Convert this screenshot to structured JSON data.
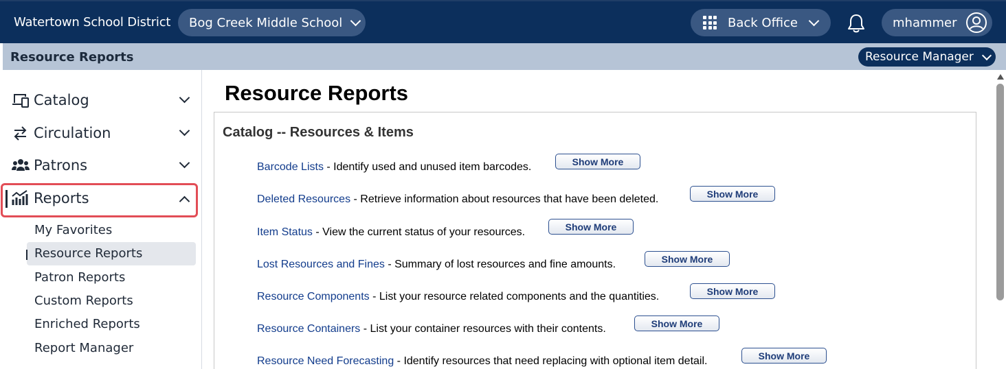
{
  "topbar": {
    "district": "Watertown School District",
    "school": "Bog Creek Middle School",
    "office": "Back Office",
    "user": "mhammer"
  },
  "subbar": {
    "title": "Resource Reports",
    "role": "Resource Manager"
  },
  "sidebar": {
    "items": [
      {
        "label": "Catalog",
        "icon": "catalog-icon"
      },
      {
        "label": "Circulation",
        "icon": "circulation-icon"
      },
      {
        "label": "Patrons",
        "icon": "patrons-icon"
      },
      {
        "label": "Reports",
        "icon": "reports-icon"
      }
    ],
    "sub_items": [
      "My Favorites",
      "Resource Reports",
      "Patron Reports",
      "Custom Reports",
      "Enriched Reports",
      "Report Manager"
    ]
  },
  "main": {
    "title": "Resource Reports",
    "section_title": "Catalog -- Resources & Items",
    "show_more_label": "Show More",
    "reports": [
      {
        "name": "Barcode Lists",
        "desc": " - Identify used and unused item barcodes."
      },
      {
        "name": "Deleted Resources",
        "desc": " - Retrieve information about resources that have been deleted."
      },
      {
        "name": "Item Status",
        "desc": " - View the current status of your resources."
      },
      {
        "name": "Lost Resources and Fines",
        "desc": " - Summary of lost resources and fine amounts."
      },
      {
        "name": "Resource Components",
        "desc": " - List your resource related components and the quantities."
      },
      {
        "name": "Resource Containers",
        "desc": " - List your container resources with their contents."
      },
      {
        "name": "Resource Need Forecasting",
        "desc": " - Identify resources that need replacing with optional item detail."
      }
    ]
  },
  "colors": {
    "topbar": "#0c2f5c",
    "subbar": "#b6c4d6",
    "link": "#123c8c",
    "highlight_border": "#e24d56"
  }
}
